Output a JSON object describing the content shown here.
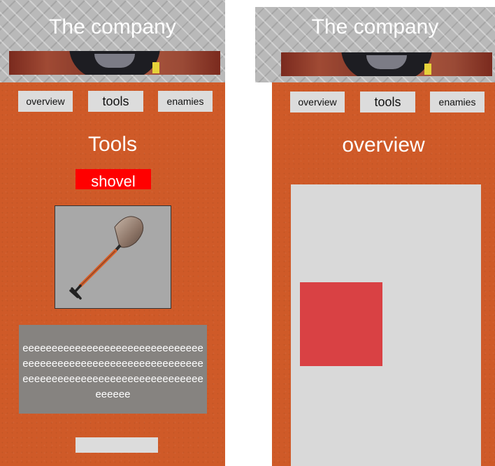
{
  "left_screen": {
    "header_title": "The company",
    "nav": [
      "overview",
      "tools",
      "enamies"
    ],
    "section_title": "Tools",
    "tool_name": "shovel",
    "description": "eeeeeeeeeeeeeeeeeeeeeeeeeeeeeeeeeeeeeeeeeeeeeeeeeeeeeeeeeeeeeeeeeeeeeeeeeeeeeeeeeeeeeeeeeeeeeeeeeee"
  },
  "right_screen": {
    "header_title": "The company",
    "nav": [
      "overview",
      "tools",
      "enamies"
    ],
    "section_title": "overview"
  },
  "colors": {
    "background_orange": "#cf5a28",
    "tool_badge": "#ff0000",
    "overview_block": "#d94144"
  }
}
